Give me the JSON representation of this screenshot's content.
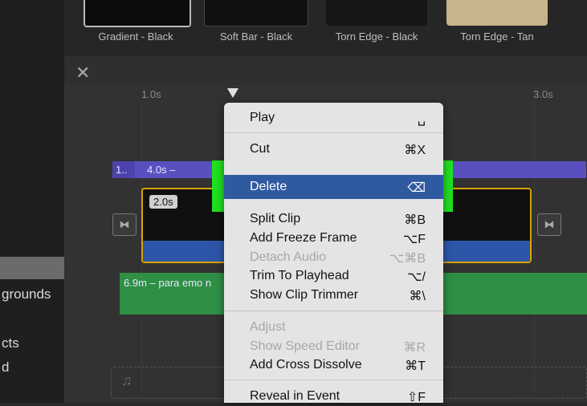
{
  "titles": [
    {
      "caption": "Gradient - Black"
    },
    {
      "caption": "Soft Bar - Black"
    },
    {
      "caption": "Torn Edge - Black"
    },
    {
      "caption": "Torn Edge - Tan"
    }
  ],
  "sidebar": {
    "items": [
      "grounds",
      "cts",
      "d"
    ]
  },
  "timeline": {
    "ticks": [
      "1.0s",
      "3.0s"
    ],
    "title_clip_short": "1..",
    "title_clip_label": "4.0s –",
    "video_duration": "2.0s",
    "audio_label": "6.9m – para emo n"
  },
  "context_menu": {
    "items": [
      {
        "label": "Play",
        "shortcut": "␣"
      },
      {
        "label": "Cut",
        "shortcut": "⌘X"
      },
      {
        "label": "Delete",
        "shortcut": "⌫"
      },
      {
        "label": "Split Clip",
        "shortcut": "⌘B"
      },
      {
        "label": "Add Freeze Frame",
        "shortcut": "⌥F"
      },
      {
        "label": "Detach Audio",
        "shortcut": "⌥⌘B"
      },
      {
        "label": "Trim To Playhead",
        "shortcut": "⌥/"
      },
      {
        "label": "Show Clip Trimmer",
        "shortcut": "⌘\\"
      },
      {
        "label": "Adjust",
        "shortcut": ""
      },
      {
        "label": "Show Speed Editor",
        "shortcut": "⌘R"
      },
      {
        "label": "Add Cross Dissolve",
        "shortcut": "⌘T"
      },
      {
        "label": "Reveal in Event",
        "shortcut": "⇧F"
      }
    ]
  },
  "colors": {
    "highlight": "#20e020",
    "selection": "#2f5aa0",
    "title_clip": "#5a4fbf",
    "audio_clip": "#2f8f45",
    "video_border": "#d6a400"
  }
}
